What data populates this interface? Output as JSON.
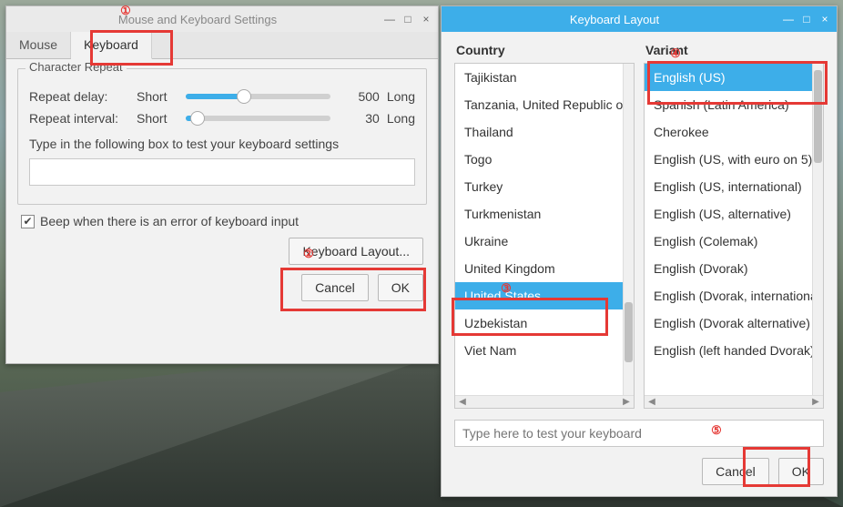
{
  "win1": {
    "title": "Mouse and Keyboard Settings",
    "tabs": {
      "mouse": "Mouse",
      "keyboard": "Keyboard"
    },
    "group_legend": "Character Repeat",
    "repeat_delay_label": "Repeat delay:",
    "repeat_interval_label": "Repeat interval:",
    "short": "Short",
    "long": "Long",
    "delay_value": "500",
    "interval_value": "30",
    "delay_slider_pct": 40,
    "interval_slider_pct": 8,
    "test_hint": "Type in the following box to test your keyboard settings",
    "beep_label": "Beep when there is an error of keyboard input",
    "beep_checked": true,
    "layout_btn": "Keyboard Layout...",
    "cancel": "Cancel",
    "ok": "OK"
  },
  "win2": {
    "title": "Keyboard Layout",
    "country_head": "Country",
    "variant_head": "Variant",
    "countries": [
      "Tajikistan",
      "Tanzania, United Republic of",
      "Thailand",
      "Togo",
      "Turkey",
      "Turkmenistan",
      "Ukraine",
      "United Kingdom",
      "United States",
      "Uzbekistan",
      "Viet Nam"
    ],
    "country_selected_index": 8,
    "variants": [
      "English (US)",
      "Spanish (Latin America)",
      "Cherokee",
      "English (US, with euro on 5)",
      "English (US, international)",
      "English (US, alternative)",
      "English (Colemak)",
      "English (Dvorak)",
      "English (Dvorak, international)",
      "English (Dvorak alternative)",
      "English (left handed Dvorak)"
    ],
    "variant_selected_index": 0,
    "test_placeholder": "Type here to test your keyboard",
    "cancel": "Cancel",
    "ok": "OK"
  },
  "annotations": {
    "1": "①",
    "2": "②",
    "3": "③",
    "4": "④",
    "5": "⑤"
  },
  "icons": {
    "min": "—",
    "max": "□",
    "close": "×",
    "check": "✔"
  }
}
